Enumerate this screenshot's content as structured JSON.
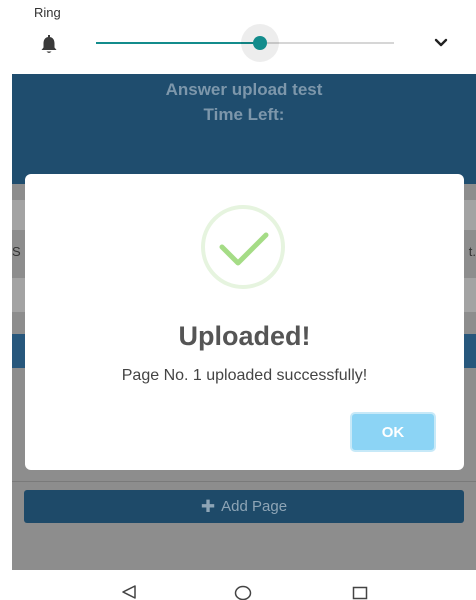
{
  "volume_panel": {
    "stream_label": "Ring",
    "level": 0.55,
    "bell_icon": "bell-icon",
    "expand_icon": "chevron-down-icon",
    "accent_color": "#138c8c"
  },
  "app": {
    "title": "Answer upload test",
    "time_left_label": "Time Left:",
    "left_edge_text": "S",
    "right_edge_text": "t.",
    "add_page_icon": "plus-icon",
    "add_page_label": "Add Page",
    "header_color": "#1f4d6e"
  },
  "dialog": {
    "icon": "check-icon",
    "title": "Uploaded!",
    "message": "Page No. 1 uploaded successfully!",
    "ok_label": "OK",
    "ok_color": "#8cd4f5",
    "check_color": "#a5dc86"
  },
  "nav_bar": {
    "back_icon": "back-icon",
    "home_icon": "home-icon",
    "recents_icon": "recents-icon"
  }
}
